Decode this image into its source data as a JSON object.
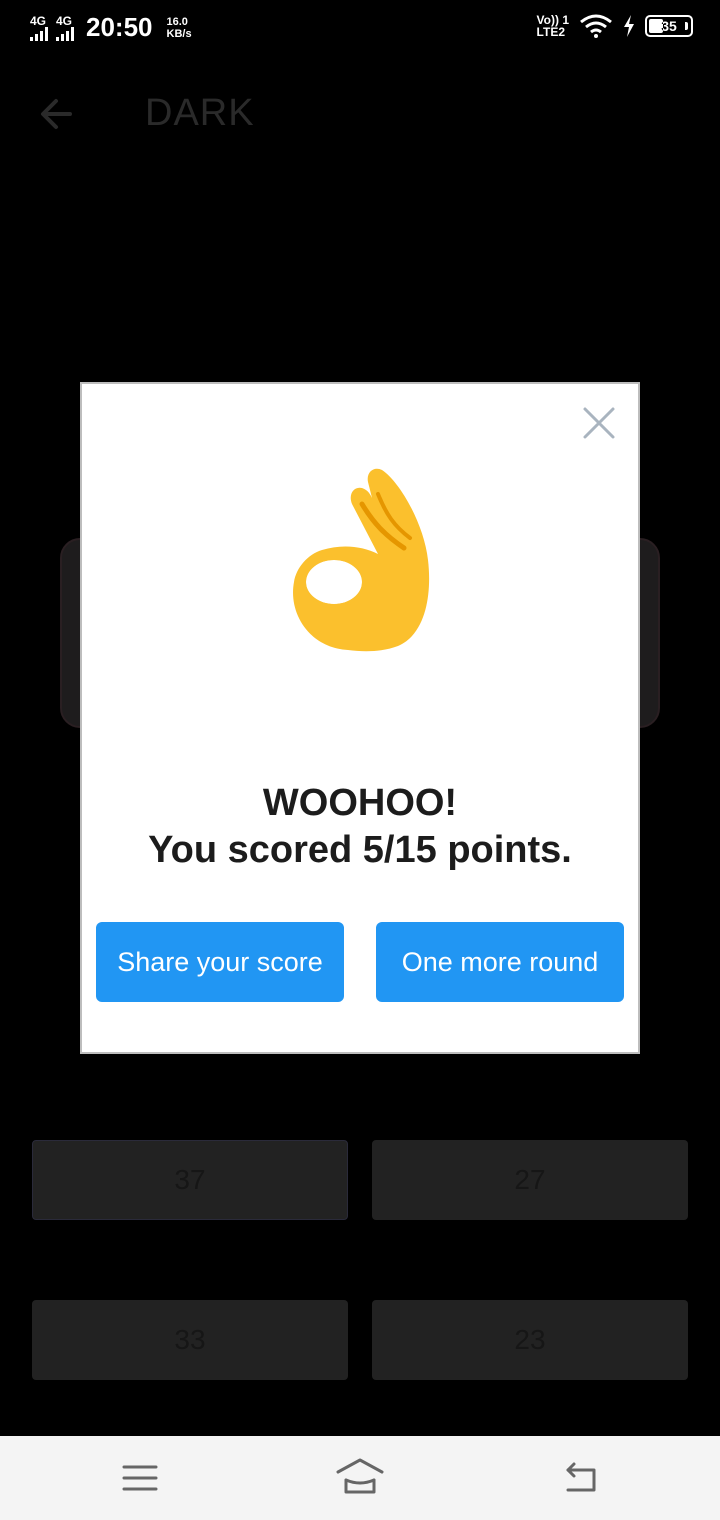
{
  "status_bar": {
    "network1": "4G",
    "network2": "4G",
    "time": "20:50",
    "speed_value": "16.0",
    "speed_unit": "KB/s",
    "volte_top": "Vo)) 1",
    "volte_bottom": "LTE2",
    "battery": "35",
    "battery_level": 0.35
  },
  "app_bar": {
    "title": "DARK",
    "back_icon": "arrow-left-icon"
  },
  "answers": [
    "37",
    "27",
    "33",
    "23"
  ],
  "dialog": {
    "close_icon": "close-icon",
    "emoji": "ok-hand-icon",
    "heading": "WOOHOO!",
    "score_text": "You scored 5/15 points.",
    "share_label": "Share your score",
    "more_label": "One more round"
  },
  "nav_bar": {
    "menu_icon": "menu-icon",
    "home_icon": "home-icon",
    "back_icon": "back-icon"
  },
  "colors": {
    "button": "#2196f3",
    "emoji_yellow": "#fbc02d",
    "emoji_shadow": "#e59600"
  }
}
